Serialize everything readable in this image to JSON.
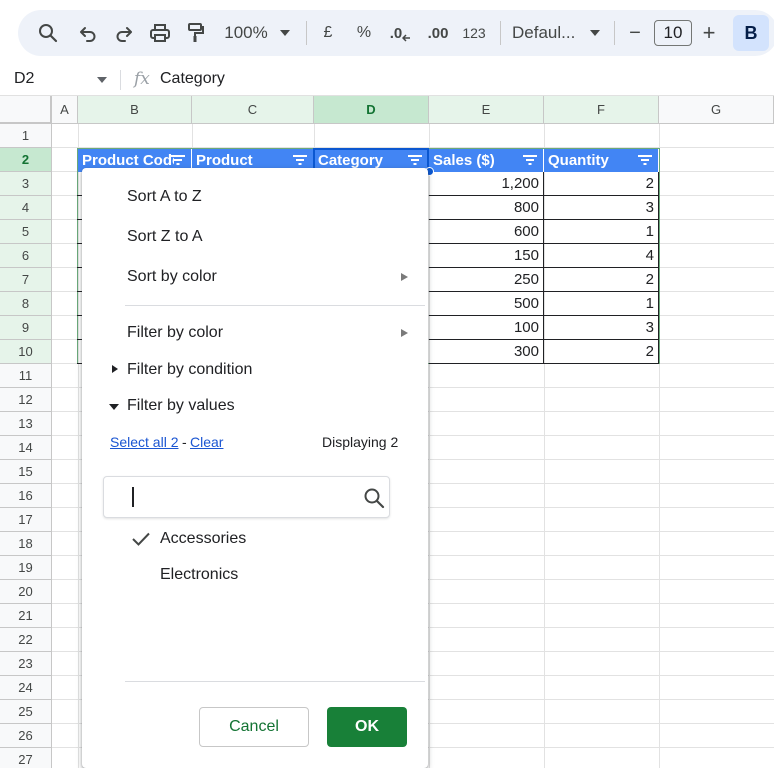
{
  "toolbar": {
    "zoom": "100%",
    "currency": "£",
    "percent": "%",
    "decrease_decimal": ".0",
    "increase_decimal": ".00",
    "number_format": "123",
    "font": "Defaul...",
    "font_size_minus": "−",
    "font_size": "10",
    "font_size_plus": "+",
    "bold": "B"
  },
  "formula_bar": {
    "cell_ref": "D2",
    "fx": "fx",
    "content": "Category"
  },
  "columns": [
    "A",
    "B",
    "C",
    "D",
    "E",
    "F",
    "G"
  ],
  "rows": [
    "1",
    "2",
    "3",
    "4",
    "5",
    "6",
    "7",
    "8",
    "9",
    "10",
    "11",
    "12",
    "13",
    "14",
    "15",
    "16",
    "17",
    "18",
    "19",
    "20",
    "21",
    "22",
    "23",
    "24",
    "25",
    "26",
    "27"
  ],
  "table": {
    "headers": [
      "Product Code",
      "Product",
      "Category",
      "Sales ($)",
      "Quantity"
    ],
    "sales": [
      "1,200",
      "800",
      "600",
      "150",
      "250",
      "500",
      "100",
      "300"
    ],
    "quantity": [
      "2",
      "3",
      "1",
      "4",
      "2",
      "1",
      "3",
      "2"
    ]
  },
  "filter_menu": {
    "sort_az": "Sort A to Z",
    "sort_za": "Sort Z to A",
    "sort_by_color": "Sort by color",
    "filter_by_color": "Filter by color",
    "filter_by_condition": "Filter by condition",
    "filter_by_values": "Filter by values",
    "select_all": "Select all 2",
    "dash": "-",
    "clear": "Clear",
    "displaying": "Displaying 2",
    "search_value": "",
    "values": [
      {
        "label": "Accessories",
        "checked": true
      },
      {
        "label": "Electronics",
        "checked": false
      }
    ],
    "cancel": "Cancel",
    "ok": "OK"
  },
  "colors": {
    "header_fill": "#4285f4",
    "ok_button": "#188038",
    "selection": "#0b57d0"
  }
}
